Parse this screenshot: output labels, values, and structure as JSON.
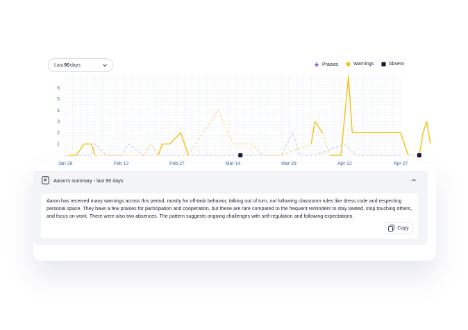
{
  "range_select": {
    "prefix": "Last",
    "number": "90",
    "suffix": "days"
  },
  "legend": [
    {
      "label": "Praises",
      "color": "#7b6ce6",
      "icon": "star-icon"
    },
    {
      "label": "Warnings",
      "color": "#f3c31b",
      "icon": "circle-icon"
    },
    {
      "label": "Absent",
      "color": "#1a1c3a",
      "icon": "square-icon"
    }
  ],
  "chart_data": {
    "type": "line",
    "x_tick_labels": [
      "Jan 28",
      "Feb 12",
      "Feb 27",
      "Mar 14",
      "Mar 28",
      "Apr 12",
      "Apr 27"
    ],
    "y_tick_labels": [
      "1",
      "2",
      "3",
      "4",
      "5",
      "6"
    ],
    "xlim": [
      "2024-01-28",
      "2024-04-27"
    ],
    "ylim": [
      0,
      7
    ],
    "grid": true,
    "legend_position": "top-right",
    "series": [
      {
        "name": "Praises",
        "color": "#c9c6f3",
        "dashed": true,
        "points": [
          [
            "2024-01-28",
            0
          ],
          [
            "2024-02-02",
            0
          ],
          [
            "2024-02-04",
            0
          ],
          [
            "2024-02-05",
            1
          ],
          [
            "2024-02-08",
            0
          ],
          [
            "2024-02-12",
            0
          ],
          [
            "2024-02-14",
            1
          ],
          [
            "2024-02-18",
            0
          ],
          [
            "2024-02-20",
            0
          ],
          [
            "2024-03-14",
            0
          ],
          [
            "2024-03-26",
            0
          ],
          [
            "2024-03-29",
            2
          ],
          [
            "2024-03-31",
            0
          ],
          [
            "2024-04-02",
            0
          ],
          [
            "2024-04-04",
            0
          ],
          [
            "2024-04-12",
            1
          ],
          [
            "2024-04-15",
            0
          ],
          [
            "2024-04-18",
            0
          ],
          [
            "2024-04-27",
            0
          ]
        ]
      },
      {
        "name": "Warnings",
        "color": "#f3c31b",
        "segments": [
          {
            "dashed": false,
            "points": [
              [
                "2024-01-29",
                0
              ],
              [
                "2024-01-31",
                0
              ],
              [
                "2024-02-02",
                1
              ],
              [
                "2024-02-04",
                1
              ],
              [
                "2024-02-05",
                0
              ]
            ]
          },
          {
            "dashed": true,
            "points": [
              [
                "2024-02-05",
                0
              ],
              [
                "2024-02-12",
                0
              ],
              [
                "2024-02-18",
                0
              ],
              [
                "2024-02-20",
                1
              ],
              [
                "2024-02-22",
                0
              ]
            ]
          },
          {
            "dashed": false,
            "points": [
              [
                "2024-02-22",
                0
              ],
              [
                "2024-02-23",
                1
              ],
              [
                "2024-02-25",
                1
              ],
              [
                "2024-02-28",
                2
              ],
              [
                "2024-03-01",
                0
              ]
            ]
          },
          {
            "dashed": true,
            "points": [
              [
                "2024-03-01",
                0
              ],
              [
                "2024-03-09",
                4
              ],
              [
                "2024-03-13",
                1
              ],
              [
                "2024-03-18",
                1
              ],
              [
                "2024-03-21",
                0
              ],
              [
                "2024-03-26",
                0
              ],
              [
                "2024-04-03",
                1
              ]
            ]
          },
          {
            "dashed": false,
            "points": [
              [
                "2024-04-03",
                1
              ],
              [
                "2024-04-04",
                3
              ],
              [
                "2024-04-06",
                2
              ]
            ]
          },
          {
            "dashed": true,
            "points": [
              [
                "2024-04-06",
                2
              ],
              [
                "2024-04-08",
                0
              ]
            ]
          },
          {
            "dashed": false,
            "points": [
              [
                "2024-04-08",
                0
              ],
              [
                "2024-04-11",
                0
              ],
              [
                "2024-04-13",
                7
              ],
              [
                "2024-04-14",
                2
              ],
              [
                "2024-04-24",
                2
              ],
              [
                "2024-04-26",
                2
              ],
              [
                "2024-04-27",
                2
              ],
              [
                "2024-04-28",
                1
              ],
              [
                "2024-04-29",
                0
              ]
            ]
          },
          {
            "dashed": true,
            "points": [
              [
                "2024-04-29",
                0
              ],
              [
                "2024-05-01",
                0
              ]
            ]
          },
          {
            "dashed": false,
            "points": [
              [
                "2024-05-02",
                0
              ],
              [
                "2024-05-03",
                2
              ],
              [
                "2024-05-04",
                3
              ],
              [
                "2024-05-05",
                1
              ]
            ]
          }
        ]
      },
      {
        "name": "Absent",
        "color": "#1a1c3a",
        "points": [
          [
            "2024-03-15",
            0
          ],
          [
            "2024-05-02",
            0
          ]
        ]
      }
    ]
  },
  "summary": {
    "title": "Aaron's summary - last 90 days",
    "text": "Aaron has received many warnings across this period, mostly for off-task behavior, talking out of turn, not following classroom rules like dress code and respecting personal space. They have a few praises for participation and cooperation, but these are rare compared to the frequent reminders to stay seated, stop touching others, and focus on work. There were also two absences. The pattern suggests ongoing challenges with self-regulation and following expectations.",
    "copy_label": "Copy"
  }
}
